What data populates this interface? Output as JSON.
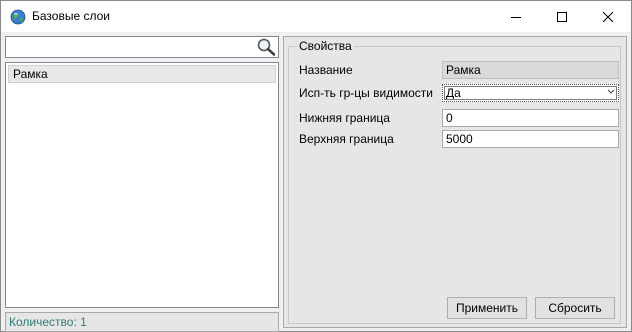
{
  "window": {
    "title": "Базовые слои",
    "app_icon": "globe-icon"
  },
  "search": {
    "value": "",
    "icon": "magnifier-icon"
  },
  "list": {
    "items": [
      {
        "label": "Рамка"
      }
    ]
  },
  "status": {
    "text": "Количество: 1"
  },
  "properties": {
    "group_title": "Свойства",
    "rows": [
      {
        "label": "Название",
        "value": "Рамка"
      },
      {
        "label": "Исп-ть гр-цы видимости",
        "value": "Да"
      },
      {
        "label": "Нижняя граница",
        "value": "0"
      },
      {
        "label": "Верхняя граница",
        "value": "5000"
      }
    ],
    "apply_label": "Применить",
    "reset_label": "Сбросить"
  },
  "colors": {
    "status_text": "#2e7d7a",
    "readonly_bg": "#d9d9d9",
    "panel_bg": "#e6e6e6"
  }
}
